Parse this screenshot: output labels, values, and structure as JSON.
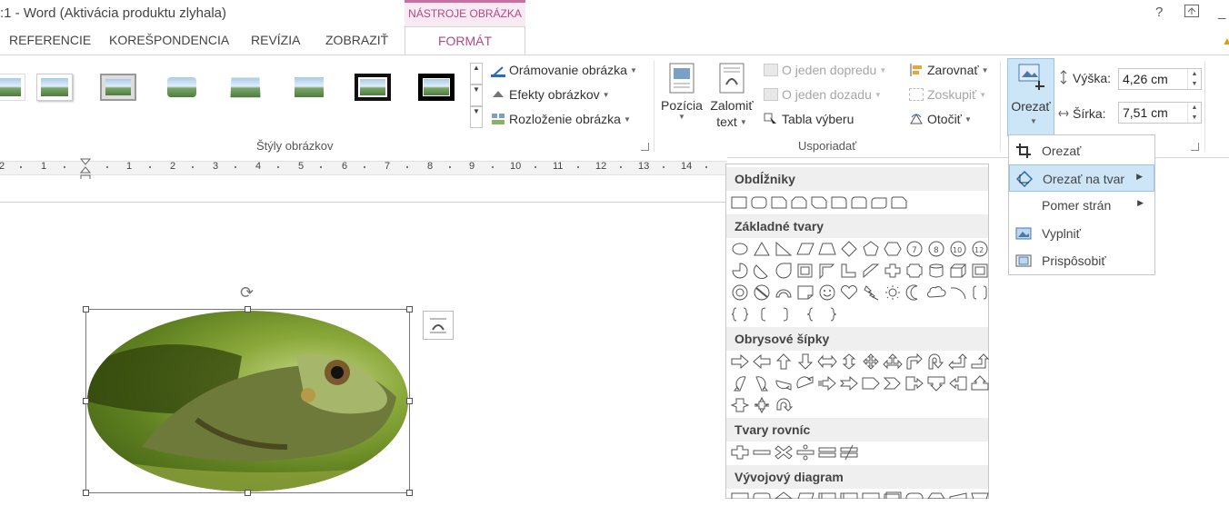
{
  "window": {
    "title": "1 - Word (Aktivácia produktu zlyhala)",
    "title_visible": ":1 - Word (Aktivácia produktu zlyhala)",
    "context_tab_group": "NÁSTROJE OBRÁZKA",
    "help": "?",
    "minimize": "_"
  },
  "tabs": [
    "REFERENCIE",
    "KOREŠPONDENCIA",
    "REVÍZIA",
    "ZOBRAZIŤ"
  ],
  "active_tab": "FORMÁT",
  "ribbon": {
    "picture_styles": {
      "label": "Štýly obrázkov",
      "commands": {
        "border": "Orámovanie obrázka",
        "effects": "Efekty obrázkov",
        "layout": "Rozloženie obrázka"
      }
    },
    "arrange": {
      "label": "Usporiadať",
      "position": "Pozícia",
      "wrap_text_line1": "Zalomiť",
      "wrap_text_line2": "text",
      "bring_forward": "O jeden dopredu",
      "send_backward": "O jeden dozadu",
      "selection_pane": "Tabla výberu",
      "align": "Zarovnať",
      "group": "Zoskupiť",
      "rotate": "Otočiť"
    },
    "size": {
      "crop": "Orezať",
      "height_label": "Výška:",
      "height_value": "4,26 cm",
      "width_label": "Šírka:",
      "width_value": "7,51 cm"
    }
  },
  "ruler": {
    "numbers": [
      "2",
      "1",
      "1",
      "1",
      "2",
      "3",
      "4",
      "5",
      "6",
      "7",
      "8",
      "9",
      "10",
      "11",
      "12",
      "13",
      "14"
    ]
  },
  "shapes_gallery": {
    "sections": [
      {
        "title": "Obdĺžniky"
      },
      {
        "title": "Základné tvary"
      },
      {
        "title": "Obrysové šípky"
      },
      {
        "title": "Tvary rovníc"
      },
      {
        "title": "Vývojový diagram"
      }
    ]
  },
  "crop_menu": {
    "items": [
      {
        "label": "Orezať",
        "icon": "crop-icon",
        "submenu": false
      },
      {
        "label": "Orezať na tvar",
        "icon": "crop-to-shape-icon",
        "submenu": true,
        "highlighted": true
      },
      {
        "label": "Pomer strán",
        "icon": "",
        "submenu": true
      },
      {
        "label": "Vyplniť",
        "icon": "fill-icon",
        "submenu": false
      },
      {
        "label": "Prispôsobiť",
        "icon": "fit-icon",
        "submenu": false
      }
    ]
  },
  "colors": {
    "accent": "#b04a85",
    "highlight": "#cde6f7",
    "highlight_border": "#9cc6e8"
  }
}
